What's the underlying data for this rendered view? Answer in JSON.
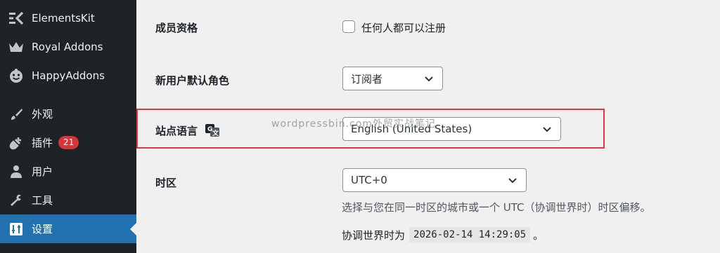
{
  "sidebar": {
    "items": [
      {
        "label": "ElementsKit",
        "icon": "elementskit-icon"
      },
      {
        "label": "Royal Addons",
        "icon": "crown-icon"
      },
      {
        "label": "HappyAddons",
        "icon": "happy-face-icon"
      },
      {
        "label": "外观",
        "icon": "paintbrush-icon"
      },
      {
        "label": "插件",
        "icon": "plugin-icon",
        "badge": "21"
      },
      {
        "label": "用户",
        "icon": "user-icon"
      },
      {
        "label": "工具",
        "icon": "wrench-icon"
      },
      {
        "label": "设置",
        "icon": "settings-icon",
        "active": true
      }
    ]
  },
  "settings": {
    "membership": {
      "label": "成员资格",
      "checkbox_label": "任何人都可以注册",
      "checked": false
    },
    "default_role": {
      "label": "新用户默认角色",
      "value": "订阅者"
    },
    "site_language": {
      "label": "站点语言",
      "value": "English (United States)"
    },
    "timezone": {
      "label": "时区",
      "value": "UTC+0",
      "description": "选择与您在同一时区的城市或一个 UTC（协调世界时）时区偏移。",
      "utc_prefix": "协调世界时为",
      "utc_time": "2026-02-14 14:29:05",
      "utc_suffix": "。"
    }
  },
  "watermark": "wordpressbin.com外贸实战笔记",
  "colors": {
    "sidebar_bg": "#1d2327",
    "active_bg": "#2271b1",
    "badge_bg": "#d63638",
    "highlight_border": "#e2373f"
  }
}
